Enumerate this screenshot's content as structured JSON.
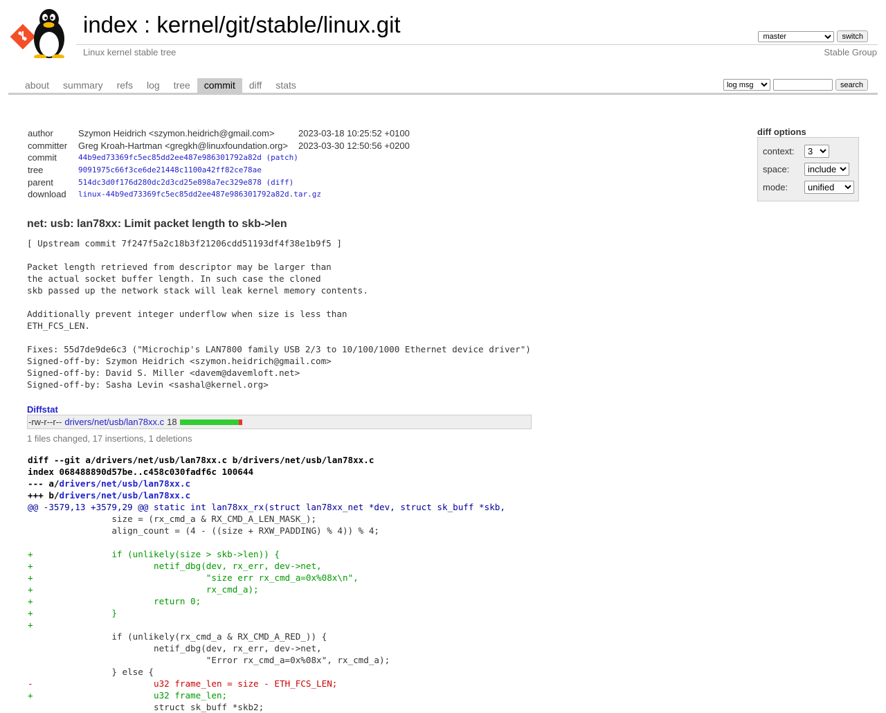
{
  "header": {
    "title": "index : kernel/git/stable/linux.git",
    "description": "Linux kernel stable tree",
    "owner": "Stable Group",
    "branch": "master",
    "switch_label": "switch"
  },
  "tabs": [
    {
      "label": "about",
      "active": false
    },
    {
      "label": "summary",
      "active": false
    },
    {
      "label": "refs",
      "active": false
    },
    {
      "label": "log",
      "active": false
    },
    {
      "label": "tree",
      "active": false
    },
    {
      "label": "commit",
      "active": true
    },
    {
      "label": "diff",
      "active": false
    },
    {
      "label": "stats",
      "active": false
    }
  ],
  "search": {
    "scope": "log msg",
    "query": "",
    "button_label": "search"
  },
  "diff_options": {
    "title": "diff options",
    "context_label": "context:",
    "context_value": "3",
    "space_label": "space:",
    "space_value": "include",
    "mode_label": "mode:",
    "mode_value": "unified"
  },
  "commit": {
    "author_label": "author",
    "author": "Szymon Heidrich <szymon.heidrich@gmail.com>",
    "author_date": "2023-03-18 10:25:52 +0100",
    "committer_label": "committer",
    "committer": "Greg Kroah-Hartman <gregkh@linuxfoundation.org>",
    "committer_date": "2023-03-30 12:50:56 +0200",
    "commit_label": "commit",
    "commit_sha": "44b9ed73369fc5ec85dd2ee487e986301792a82d",
    "patch_link": "(patch)",
    "tree_label": "tree",
    "tree_sha": "9091975c66f3ce6de21448c1100a42ff82ce78ae",
    "parent_label": "parent",
    "parent_sha": "514dc3d0f176d280dc2d3cd25e898a7ec329e878",
    "diff_link": "(diff)",
    "download_label": "download",
    "download_file": "linux-44b9ed73369fc5ec85dd2ee487e986301792a82d.tar.gz",
    "subject": "net: usb: lan78xx: Limit packet length to skb->len",
    "message": "[ Upstream commit 7f247f5a2c18b3f21206cdd51193df4f38e1b9f5 ]\n\nPacket length retrieved from descriptor may be larger than\nthe actual socket buffer length. In such case the cloned\nskb passed up the network stack will leak kernel memory contents.\n\nAdditionally prevent integer underflow when size is less than\nETH_FCS_LEN.\n\nFixes: 55d7de9de6c3 (\"Microchip's LAN7800 family USB 2/3 to 10/100/1000 Ethernet device driver\")\nSigned-off-by: Szymon Heidrich <szymon.heidrich@gmail.com>\nSigned-off-by: David S. Miller <davem@davemloft.net>\nSigned-off-by: Sasha Levin <sashal@kernel.org>"
  },
  "diffstat": {
    "title": "Diffstat",
    "mode": "-rw-r--r--",
    "file": "drivers/net/usb/lan78xx.c",
    "changes": "18",
    "insertions": 17,
    "deletions": 1,
    "summary": "1 files changed, 17 insertions, 1 deletions"
  },
  "diff": {
    "header_1": "diff --git a/drivers/net/usb/lan78xx.c b/drivers/net/usb/lan78xx.c",
    "header_2": "index 068488890d57be..c458c030fadf6c 100644",
    "minus_prefix": "--- a/",
    "minus_file": "drivers/net/usb/lan78xx.c",
    "plus_prefix": "+++ b/",
    "plus_file": "drivers/net/usb/lan78xx.c",
    "lines": [
      {
        "type": "hunk",
        "text": "@@ -3579,13 +3579,29 @@ static int lan78xx_rx(struct lan78xx_net *dev, struct sk_buff *skb,"
      },
      {
        "type": "ctx",
        "text": " \t\tsize = (rx_cmd_a & RX_CMD_A_LEN_MASK_);"
      },
      {
        "type": "ctx",
        "text": " \t\talign_count = (4 - ((size + RXW_PADDING) % 4)) % 4;"
      },
      {
        "type": "ctx",
        "text": " "
      },
      {
        "type": "add",
        "text": "+\t\tif (unlikely(size > skb->len)) {"
      },
      {
        "type": "add",
        "text": "+\t\t\tnetif_dbg(dev, rx_err, dev->net,"
      },
      {
        "type": "add",
        "text": "+\t\t\t\t  \"size err rx_cmd_a=0x%08x\\n\","
      },
      {
        "type": "add",
        "text": "+\t\t\t\t  rx_cmd_a);"
      },
      {
        "type": "add",
        "text": "+\t\t\treturn 0;"
      },
      {
        "type": "add",
        "text": "+\t\t}"
      },
      {
        "type": "add",
        "text": "+"
      },
      {
        "type": "ctx",
        "text": " \t\tif (unlikely(rx_cmd_a & RX_CMD_A_RED_)) {"
      },
      {
        "type": "ctx",
        "text": " \t\t\tnetif_dbg(dev, rx_err, dev->net,"
      },
      {
        "type": "ctx",
        "text": " \t\t\t\t  \"Error rx_cmd_a=0x%08x\", rx_cmd_a);"
      },
      {
        "type": "ctx",
        "text": " \t\t} else {"
      },
      {
        "type": "del",
        "text": "-\t\t\tu32 frame_len = size - ETH_FCS_LEN;"
      },
      {
        "type": "add",
        "text": "+\t\t\tu32 frame_len;"
      },
      {
        "type": "ctx",
        "text": " \t\t\tstruct sk_buff *skb2;"
      }
    ]
  }
}
